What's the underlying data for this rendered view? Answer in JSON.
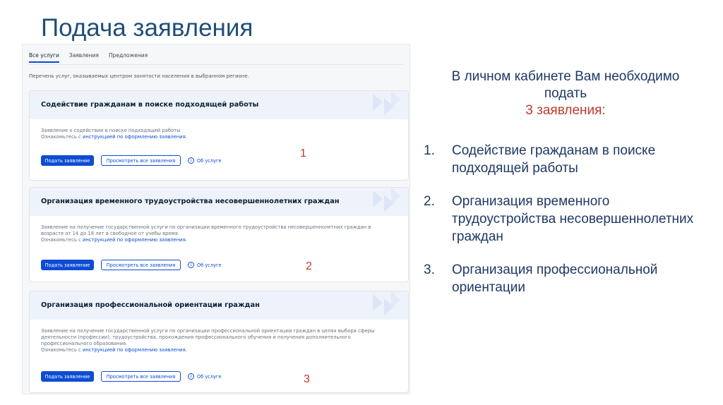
{
  "slide": {
    "title": "Подача заявления"
  },
  "portal": {
    "tabs": [
      {
        "label": "Все услуги",
        "active": true
      },
      {
        "label": "Заявления",
        "active": false
      },
      {
        "label": "Предложения",
        "active": false
      }
    ],
    "intro": "Перечень услуг, оказываемых центром занятости населения в выбранном регионе.",
    "cards": [
      {
        "title": "Содействие гражданам в поиске подходящей работы",
        "description": "Заявление о содействии в поиске подходящей работы",
        "instruction_prefix": "Ознакомьтесь с",
        "instruction_link": "инструкцией по оформлению заявления.",
        "submit_label": "Подать заявление",
        "view_all_label": "Просмотреть все заявления",
        "about_label": "Об услуге",
        "marker": "1"
      },
      {
        "title": "Организация временного трудоустройства несовершеннолетних граждан",
        "description_line1": "Заявление на получение государственной услуги по организации временного трудоустройства несовершеннолетних граждан в",
        "description_line2": "возрасте от 14 до 18 лет в свободное от учебы время.",
        "instruction_prefix": "Ознакомьтесь с",
        "instruction_link": "инструкцией по оформлению заявления.",
        "submit_label": "Подать заявление",
        "view_all_label": "Просмотреть все заявления",
        "about_label": "Об услуге",
        "marker": "2"
      },
      {
        "title": "Организация профессиональной ориентации граждан",
        "description_line1": "Заявление на получение государственной услуги по организации профессиональной ориентации граждан в целях выбора сферы",
        "description_line2": "деятельности (профессии), трудоустройства, прохождения профессионального обучения и получения дополнительного",
        "description_line3": "профессионального образования.",
        "instruction_prefix": "Ознакомьтесь с",
        "instruction_link": "инструкцией по оформлению заявления.",
        "submit_label": "Подать заявление",
        "view_all_label": "Просмотреть все заявления",
        "about_label": "Об услуге",
        "marker": "3"
      }
    ],
    "info_icon_glyph": "i",
    "colors": {
      "accent": "#0d4cd3",
      "marker": "#c0392b",
      "card_header": "#eef3fb"
    }
  },
  "note": {
    "line1": "В личном кабинете Вам необходимо",
    "line2": "подать",
    "line3": "3 заявления:"
  },
  "list": [
    {
      "num": "1.",
      "text": "Содействие гражданам в поиске подходящей работы"
    },
    {
      "num": "2.",
      "text": "Организация временного трудоустройства несовершеннолетних граждан"
    },
    {
      "num": "3.",
      "text": "Организация профессиональной ориентации"
    }
  ]
}
